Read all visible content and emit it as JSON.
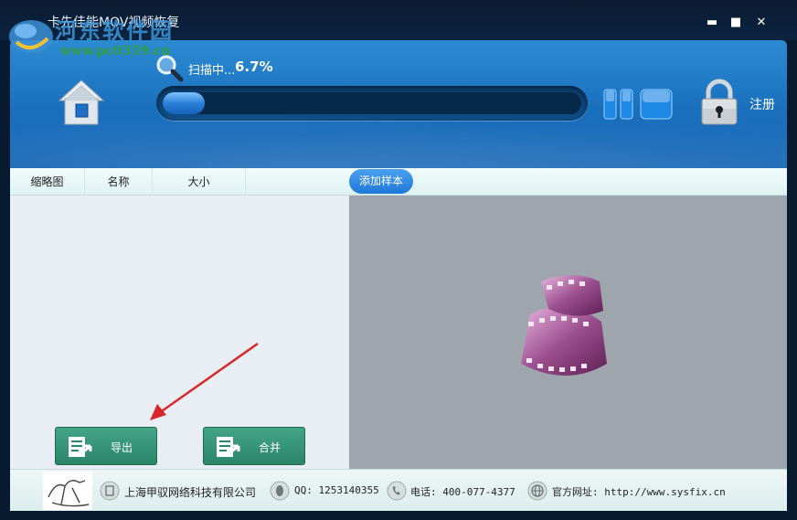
{
  "window": {
    "title": "卡先佳能MOV视频恢复",
    "watermark_text": "河东软件园",
    "watermark_url": "www.pc0359.cn",
    "controls": {
      "minimize": "▬",
      "maximize": "■",
      "close": "✕"
    }
  },
  "header": {
    "scan_label": "扫描中...",
    "scan_percent": "6.7%",
    "progress_fraction": 0.067,
    "register_label": "注册"
  },
  "columns": {
    "thumbnail": "缩略图",
    "name": "名称",
    "size": "大小",
    "add_sample": "添加样本"
  },
  "actions": {
    "export_label": "导出",
    "merge_label": "合并"
  },
  "footer": {
    "company": "上海甲驭网络科技有限公司",
    "qq": "QQ: 1253140355",
    "phone": "电话: 400-077-4377",
    "website": "官方网址: http://www.sysfix.cn"
  },
  "colors": {
    "header_blue": "#1f78c8",
    "button_green": "#349a7b",
    "pill_blue": "#2a86e4",
    "arrow_red": "#d8262a"
  }
}
